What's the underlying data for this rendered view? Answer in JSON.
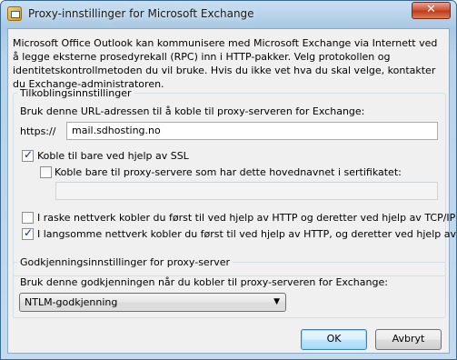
{
  "window": {
    "title": "Proxy-innstillinger for Microsoft Exchange",
    "close_glyph": "✕"
  },
  "intro_text": "Microsoft Office Outlook kan kommunisere med Microsoft Exchange via Internett ved å legge eksterne prosedyrekall (RPC) inn i HTTP-pakker. Velg protokollen og identitetskontrollmetoden du vil bruke. Hvis du ikke vet hva du skal velge, kontakter du Exchange-administratoren.",
  "connection": {
    "legend": "Tilkoblingsinnstillinger",
    "url_label": "Bruk denne URL-adressen til å koble til proxy-serveren for Exchange:",
    "url_prefix": "https://",
    "url_value": "mail.sdhosting.no",
    "ssl_only_label": "Koble til bare ved hjelp av SSL",
    "ssl_only_checked": true,
    "principal_label": "Koble bare til proxy-servere som har dette hovednavnet i sertifikatet:",
    "principal_checked": false,
    "principal_value": "",
    "fast_network_label": "I raske nettverk kobler du først til ved hjelp av HTTP og deretter ved hjelp av TCP/IP",
    "fast_network_checked": false,
    "slow_network_label": "I langsomme nettverk kobler du først til ved hjelp av HTTP, og deretter ved hjelp av TCP/IP",
    "slow_network_checked": true
  },
  "auth": {
    "legend": "Godkjenningsinnstillinger for proxy-server",
    "method_label": "Bruk denne godkjenningen når du kobler til proxy-serveren for Exchange:",
    "method_selected": "NTLM-godkjenning",
    "arrow_glyph": "▼"
  },
  "buttons": {
    "ok": "OK",
    "cancel": "Avbryt"
  }
}
